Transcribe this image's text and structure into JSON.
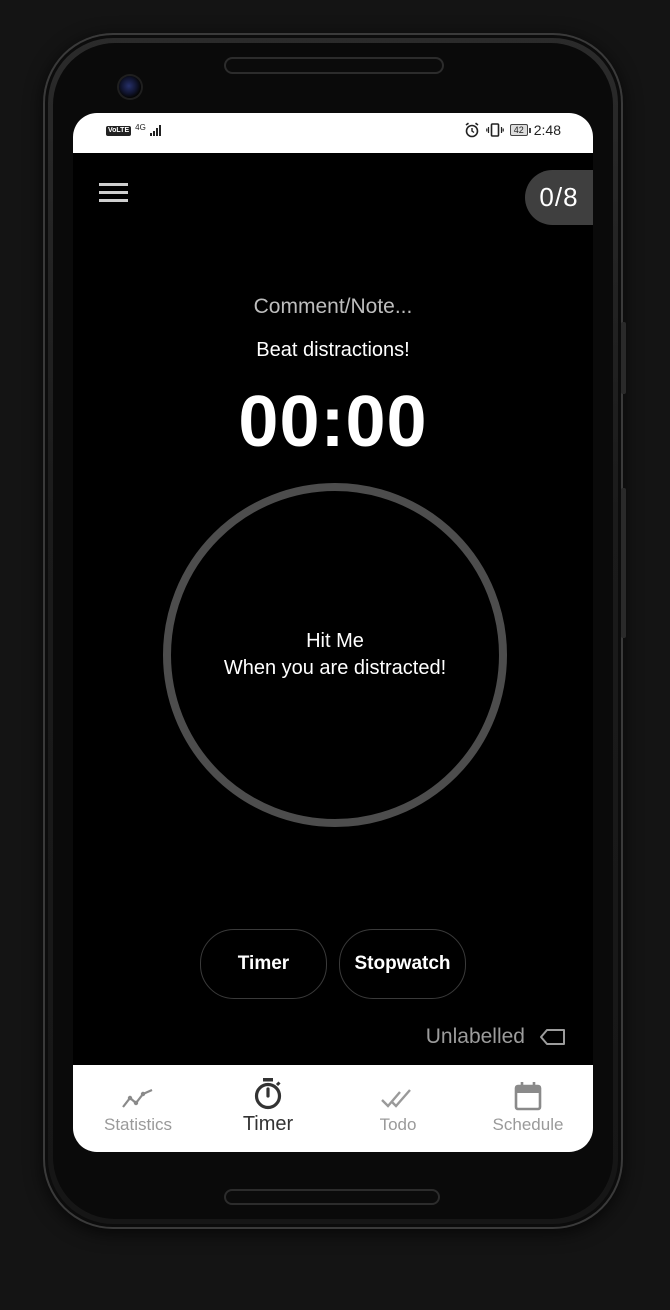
{
  "status_bar": {
    "left_badge": "VoLTE",
    "network": "4G",
    "battery": "42",
    "time": "2:48"
  },
  "header": {
    "counter": "0/8"
  },
  "main": {
    "comment_placeholder": "Comment/Note...",
    "motto": "Beat distractions!",
    "timer": "00:00",
    "hit_button": {
      "title": "Hit Me",
      "subtitle": "When you are distracted!"
    },
    "modes": {
      "timer": "Timer",
      "stopwatch": "Stopwatch"
    },
    "label": "Unlabelled"
  },
  "bottom_nav": {
    "items": [
      {
        "label": "Statistics",
        "icon": "trend-line-icon"
      },
      {
        "label": "Timer",
        "icon": "stopwatch-icon",
        "active": true
      },
      {
        "label": "Todo",
        "icon": "double-check-icon"
      },
      {
        "label": "Schedule",
        "icon": "calendar-icon"
      }
    ]
  },
  "colors": {
    "background": "#000000",
    "ring": "#4d4d4d",
    "badge": "#3f3f3f",
    "nav_active": "#333333",
    "nav_inactive": "#9a9a9a"
  }
}
